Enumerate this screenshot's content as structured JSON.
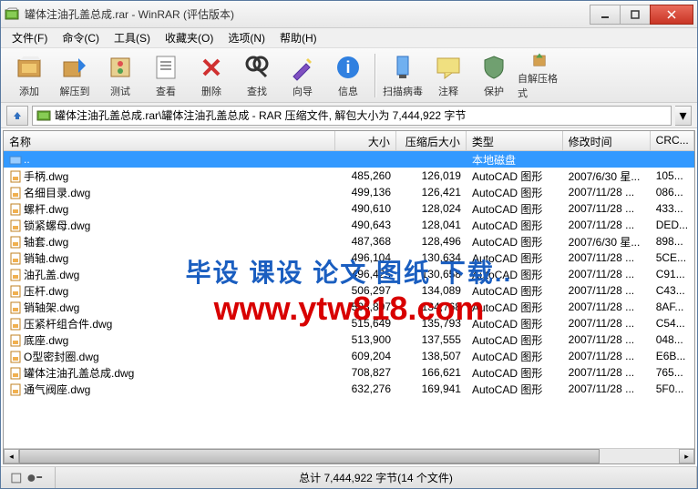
{
  "window": {
    "title": "罐体注油孔盖总成.rar - WinRAR (评估版本)"
  },
  "menu": {
    "items": [
      "文件(F)",
      "命令(C)",
      "工具(S)",
      "收藏夹(O)",
      "选项(N)",
      "帮助(H)"
    ]
  },
  "toolbar": {
    "groups": [
      [
        "添加",
        "解压到",
        "测试",
        "查看",
        "删除",
        "查找",
        "向导",
        "信息"
      ],
      [
        "扫描病毒",
        "注释",
        "保护",
        "自解压格式"
      ]
    ]
  },
  "address": {
    "path": "罐体注油孔盖总成.rar\\罐体注油孔盖总成 - RAR 压缩文件, 解包大小为 7,444,922 字节"
  },
  "columns": {
    "name": "名称",
    "size": "大小",
    "packed": "压缩后大小",
    "type": "类型",
    "date": "修改时间",
    "crc": "CRC..."
  },
  "parent_row": {
    "name": "..",
    "type": "本地磁盘"
  },
  "files": [
    {
      "name": "手柄.dwg",
      "size": "485,260",
      "packed": "126,019",
      "type": "AutoCAD 图形",
      "date": "2007/6/30 星...",
      "crc": "105..."
    },
    {
      "name": "名细目录.dwg",
      "size": "499,136",
      "packed": "126,421",
      "type": "AutoCAD 图形",
      "date": "2007/11/28 ...",
      "crc": "086..."
    },
    {
      "name": "螺杆.dwg",
      "size": "490,610",
      "packed": "128,024",
      "type": "AutoCAD 图形",
      "date": "2007/11/28 ...",
      "crc": "433..."
    },
    {
      "name": "锁紧螺母.dwg",
      "size": "490,643",
      "packed": "128,041",
      "type": "AutoCAD 图形",
      "date": "2007/11/28 ...",
      "crc": "DED..."
    },
    {
      "name": "轴套.dwg",
      "size": "487,368",
      "packed": "128,496",
      "type": "AutoCAD 图形",
      "date": "2007/6/30 星...",
      "crc": "898..."
    },
    {
      "name": "销轴.dwg",
      "size": "496,104",
      "packed": "130,634",
      "type": "AutoCAD 图形",
      "date": "2007/11/28 ...",
      "crc": "5CE..."
    },
    {
      "name": "油孔盖.dwg",
      "size": "496,425",
      "packed": "130,658",
      "type": "AutoCAD 图形",
      "date": "2007/11/28 ...",
      "crc": "C91..."
    },
    {
      "name": "压杆.dwg",
      "size": "506,297",
      "packed": "134,089",
      "type": "AutoCAD 图形",
      "date": "2007/11/28 ...",
      "crc": "C43..."
    },
    {
      "name": "销轴架.dwg",
      "size": "508,897",
      "packed": "134,768",
      "type": "AutoCAD 图形",
      "date": "2007/11/28 ...",
      "crc": "8AF..."
    },
    {
      "name": "压紧杆组合件.dwg",
      "size": "515,649",
      "packed": "135,793",
      "type": "AutoCAD 图形",
      "date": "2007/11/28 ...",
      "crc": "C54..."
    },
    {
      "name": "底座.dwg",
      "size": "513,900",
      "packed": "137,555",
      "type": "AutoCAD 图形",
      "date": "2007/11/28 ...",
      "crc": "048..."
    },
    {
      "name": "O型密封圈.dwg",
      "size": "609,204",
      "packed": "138,507",
      "type": "AutoCAD 图形",
      "date": "2007/11/28 ...",
      "crc": "E6B..."
    },
    {
      "name": "罐体注油孔盖总成.dwg",
      "size": "708,827",
      "packed": "166,621",
      "type": "AutoCAD 图形",
      "date": "2007/11/28 ...",
      "crc": "765..."
    },
    {
      "name": "通气阀座.dwg",
      "size": "632,276",
      "packed": "169,941",
      "type": "AutoCAD 图形",
      "date": "2007/11/28 ...",
      "crc": "5F0..."
    }
  ],
  "status": {
    "total": "总计 7,444,922 字节(14 个文件)"
  },
  "watermark": {
    "line1": "毕设 课设 论文 图纸 下载..",
    "line2": "www.ytw818.com"
  },
  "icons": {
    "archive": "archive-icon",
    "up": "up-icon"
  }
}
